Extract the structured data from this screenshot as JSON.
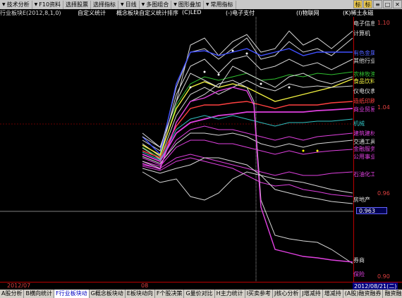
{
  "toolbar": {
    "items": [
      "技术分析",
      "F10资料",
      "选择股票",
      "选择指标",
      "日线",
      "多图组合",
      "图形叠加",
      "常用指标"
    ],
    "right_icons": [
      "标",
      "标",
      "≡",
      "□",
      "✕"
    ]
  },
  "subbar": {
    "left": "行业板块E(2012,8,1,0)",
    "mid": "自定义统计",
    "title": "概念板块自定义统计排序",
    "cl": "(C)LED",
    "center": "(-)电子支付",
    "right": "(I)物联网",
    "far": "(K)稀土永磁"
  },
  "scale_ticks": [
    "1.10",
    "1.04",
    "0.96",
    "0.90"
  ],
  "current_value": "0.963",
  "series_labels": [
    {
      "text": "电子信息",
      "color": "#e0e0e0"
    },
    {
      "text": "计算机",
      "color": "#e0e0e0"
    },
    {
      "text": "有色金属",
      "color": "#5060ff"
    },
    {
      "text": "其他行业",
      "color": "#e0e0e0"
    },
    {
      "text": "农林牧渔",
      "color": "#30c030"
    },
    {
      "text": "食品饮料",
      "color": "#f0f040"
    },
    {
      "text": "仪电仪表",
      "color": "#e0e0e0"
    },
    {
      "text": "造纸印刷",
      "color": "#ff4040"
    },
    {
      "text": "商业贸易",
      "color": "#e040e0"
    },
    {
      "text": "机械",
      "color": "#30c0c0"
    },
    {
      "text": "建筑建材",
      "color": "#e040e0"
    },
    {
      "text": "交通工具",
      "color": "#e0e0e0"
    },
    {
      "text": "金融服务",
      "color": "#e040e0"
    },
    {
      "text": "公用事业",
      "color": "#e040e0"
    },
    {
      "text": "石油化工",
      "color": "#e040e0"
    },
    {
      "text": "房地产",
      "color": "#e0e0e0"
    },
    {
      "text": "券商",
      "color": "#e0e0e0"
    },
    {
      "text": "保险",
      "color": "#e040e0"
    }
  ],
  "datebar": {
    "left": "2012/07",
    "mid": "08",
    "right": "2012/08/21(二)"
  },
  "tabs": [
    "A股分析",
    "B横向统计",
    "F行业板块动",
    "G概念板块动",
    "E板块动向",
    "F个股决策",
    "G量价对比",
    "H主力统计",
    "I买卖参考",
    "J核心分析",
    "J增减持",
    "增减持",
    "(A股)融资融券",
    "融资融券",
    "其他"
  ]
}
